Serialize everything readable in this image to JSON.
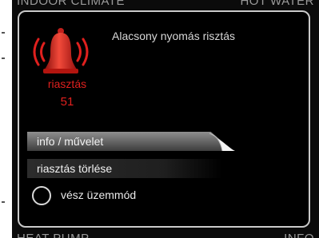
{
  "background_tabs": {
    "top_left": "INDOOR CLIMATE",
    "top_right": "HOT WATER",
    "bottom_left": "HEAT PUMP",
    "bottom_right": "INFO"
  },
  "alarm": {
    "title": "Alacsony nyomás risztás",
    "label": "riasztás",
    "code": "51",
    "icon": "alarm-bell-icon",
    "color": "#e0201e"
  },
  "menu": {
    "items": [
      {
        "label": "info / művelet",
        "selected": true
      },
      {
        "label": "riasztás törlése",
        "selected": false
      }
    ]
  },
  "emergency": {
    "label": "vész üzemmód",
    "checked": false
  }
}
